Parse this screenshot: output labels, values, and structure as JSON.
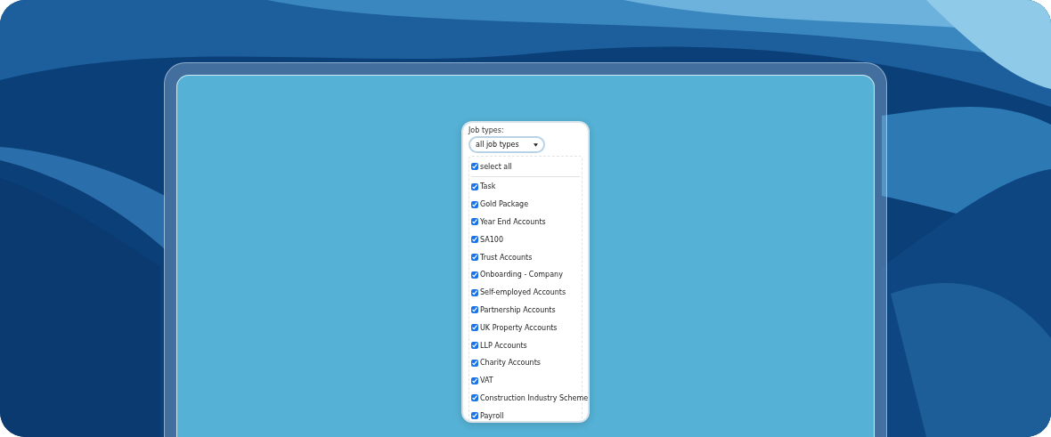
{
  "filter": {
    "label": "Job types:",
    "value": "all job types"
  },
  "select_all": {
    "label": "select all",
    "checked": true
  },
  "options": [
    {
      "label": "Task",
      "checked": true
    },
    {
      "label": "Gold Package",
      "checked": true
    },
    {
      "label": "Year End Accounts",
      "checked": true
    },
    {
      "label": "SA100",
      "checked": true
    },
    {
      "label": "Trust Accounts",
      "checked": true
    },
    {
      "label": "Onboarding - Company",
      "checked": true
    },
    {
      "label": "Self-employed Accounts",
      "checked": true
    },
    {
      "label": "Partnership Accounts",
      "checked": true
    },
    {
      "label": "UK Property Accounts",
      "checked": true
    },
    {
      "label": "LLP Accounts",
      "checked": true
    },
    {
      "label": "Charity Accounts",
      "checked": true
    },
    {
      "label": "VAT",
      "checked": true
    },
    {
      "label": "Construction Industry Scheme",
      "checked": true
    },
    {
      "label": "Payroll",
      "checked": true
    }
  ]
}
